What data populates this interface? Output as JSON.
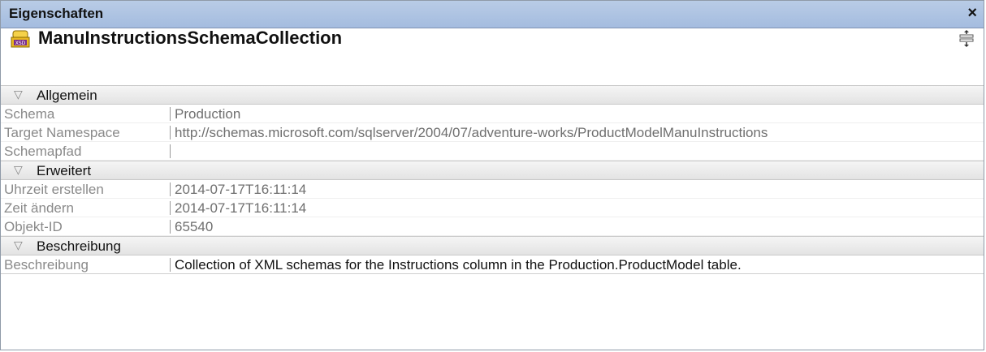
{
  "window": {
    "title": "Eigenschaften",
    "close_symbol": "×"
  },
  "object": {
    "name": "ManuInstructionsSchemaCollection",
    "icon": "xsd-schema-collection-icon",
    "layout_icon": "properties-layout-icon"
  },
  "sections": {
    "general": {
      "label": "Allgemein",
      "rows": [
        {
          "key": "Schema",
          "value": "Production"
        },
        {
          "key": "Target Namespace",
          "value": "http://schemas.microsoft.com/sqlserver/2004/07/adventure-works/ProductModelManuInstructions"
        },
        {
          "key": "Schemapfad",
          "value": ""
        }
      ]
    },
    "advanced": {
      "label": "Erweitert",
      "rows": [
        {
          "key": "Uhrzeit erstellen",
          "value": "2014-07-17T16:11:14"
        },
        {
          "key": "Zeit ändern",
          "value": "2014-07-17T16:11:14"
        },
        {
          "key": "Objekt-ID",
          "value": "65540"
        }
      ]
    },
    "description": {
      "label": "Beschreibung",
      "rows": [
        {
          "key": "Beschreibung",
          "value": "Collection of XML schemas for the Instructions column in the Production.ProductModel table."
        }
      ]
    }
  },
  "colors": {
    "titlebar": "#a4bcdf",
    "section_bg": "#e3e3e3"
  }
}
